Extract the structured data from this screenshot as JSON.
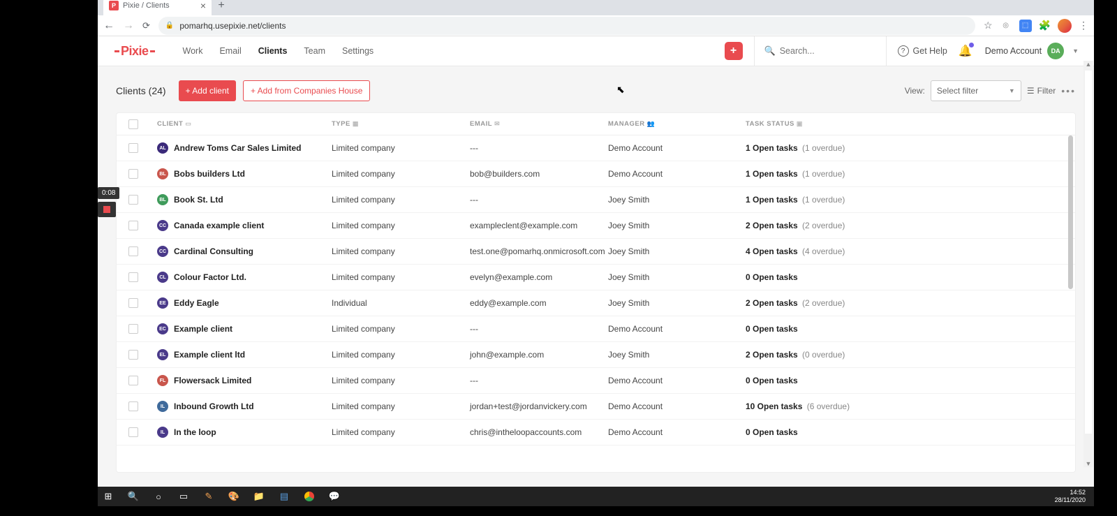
{
  "browser": {
    "tab_title": "Pixie / Clients",
    "url": "pomarhq.usepixie.net/clients"
  },
  "recorder": {
    "time": "0:08"
  },
  "header": {
    "logo": "Pixie",
    "nav": [
      "Work",
      "Email",
      "Clients",
      "Team",
      "Settings"
    ],
    "active_nav": "Clients",
    "search_placeholder": "Search...",
    "get_help": "Get Help",
    "account_name": "Demo Account",
    "account_initials": "DA"
  },
  "page": {
    "title": "Clients (24)",
    "add_client": "+ Add client",
    "add_from_ch": "+ Add from Companies House",
    "view_label": "View:",
    "filter_placeholder": "Select filter",
    "filter_label": "Filter"
  },
  "columns": {
    "client": "CLIENT",
    "type": "TYPE",
    "email": "EMAIL",
    "manager": "MANAGER",
    "task_status": "TASK STATUS"
  },
  "rows": [
    {
      "initials": "AL",
      "color": "#3b2a7a",
      "name": "Andrew Toms Car Sales Limited",
      "type": "Limited company",
      "email": "---",
      "manager": "Demo Account",
      "tasks": "1 Open tasks",
      "overdue": "(1 overdue)"
    },
    {
      "initials": "BL",
      "color": "#c9564c",
      "name": "Bobs builders Ltd",
      "type": "Limited company",
      "email": "bob@builders.com",
      "manager": "Demo Account",
      "tasks": "1 Open tasks",
      "overdue": "(1 overdue)"
    },
    {
      "initials": "BL",
      "color": "#3f9b5b",
      "name": "Book St. Ltd",
      "type": "Limited company",
      "email": "---",
      "manager": "Joey Smith",
      "tasks": "1 Open tasks",
      "overdue": "(1 overdue)"
    },
    {
      "initials": "CC",
      "color": "#4a3a8a",
      "name": "Canada example client",
      "type": "Limited company",
      "email": "exampleclent@example.com",
      "manager": "Joey Smith",
      "tasks": "2 Open tasks",
      "overdue": "(2 overdue)"
    },
    {
      "initials": "CC",
      "color": "#4a3a8a",
      "name": "Cardinal Consulting",
      "type": "Limited company",
      "email": "test.one@pomarhq.onmicrosoft.com",
      "manager": "Joey Smith",
      "tasks": "4 Open tasks",
      "overdue": "(4 overdue)"
    },
    {
      "initials": "CL",
      "color": "#4a3a8a",
      "name": "Colour Factor Ltd.",
      "type": "Limited company",
      "email": "evelyn@example.com",
      "manager": "Joey Smith",
      "tasks": "0 Open tasks",
      "overdue": ""
    },
    {
      "initials": "EE",
      "color": "#4a3a8a",
      "name": "Eddy Eagle",
      "type": "Individual",
      "email": "eddy@example.com",
      "manager": "Joey Smith",
      "tasks": "2 Open tasks",
      "overdue": "(2 overdue)"
    },
    {
      "initials": "EC",
      "color": "#4a3a8a",
      "name": "Example client",
      "type": "Limited company",
      "email": "---",
      "manager": "Demo Account",
      "tasks": "0 Open tasks",
      "overdue": ""
    },
    {
      "initials": "EL",
      "color": "#4a3a8a",
      "name": "Example client ltd",
      "type": "Limited company",
      "email": "john@example.com",
      "manager": "Joey Smith",
      "tasks": "2 Open tasks",
      "overdue": "(0 overdue)"
    },
    {
      "initials": "FL",
      "color": "#c9564c",
      "name": "Flowersack Limited",
      "type": "Limited company",
      "email": "---",
      "manager": "Demo Account",
      "tasks": "0 Open tasks",
      "overdue": ""
    },
    {
      "initials": "IL",
      "color": "#3f6a9b",
      "name": "Inbound Growth Ltd",
      "type": "Limited company",
      "email": "jordan+test@jordanvickery.com",
      "manager": "Demo Account",
      "tasks": "10 Open tasks",
      "overdue": "(6 overdue)"
    },
    {
      "initials": "IL",
      "color": "#4a3a8a",
      "name": "In the loop",
      "type": "Limited company",
      "email": "chris@intheloopaccounts.com",
      "manager": "Demo Account",
      "tasks": "0 Open tasks",
      "overdue": ""
    }
  ],
  "taskbar": {
    "time": "14:52",
    "date": "28/11/2020"
  }
}
